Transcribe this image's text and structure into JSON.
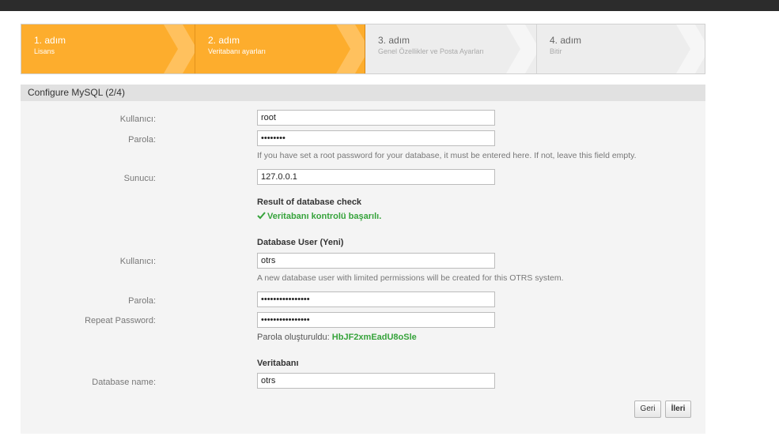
{
  "steps": [
    {
      "number": "1. adım",
      "label": "Lisans",
      "state": "done"
    },
    {
      "number": "2. adım",
      "label": "Veritabanı ayarları",
      "state": "active"
    },
    {
      "number": "3. adım",
      "label": "Genel Özellikler ve Posta Ayarları",
      "state": "pending"
    },
    {
      "number": "4. adım",
      "label": "Bitir",
      "state": "pending"
    }
  ],
  "panel": {
    "title": "Configure MySQL (2/4)"
  },
  "root_user": {
    "label": "Kullanıcı:",
    "value": "root"
  },
  "root_password": {
    "label": "Parola:",
    "value": "••••••••",
    "hint": "If you have set a root password for your database, it must be entered here. If not, leave this field empty."
  },
  "host": {
    "label": "Sunucu:",
    "value": "127.0.0.1"
  },
  "check": {
    "heading": "Result of database check",
    "result": "Veritabanı kontrolü başarılı."
  },
  "db_user_section": {
    "heading": "Database User (Yeni)",
    "user_label": "Kullanıcı:",
    "user_value": "otrs",
    "user_hint": "A new database user with limited permissions will be created for this OTRS system.",
    "password_label": "Parola:",
    "password_value": "••••••••••••••••",
    "repeat_label": "Repeat Password:",
    "repeat_value": "••••••••••••••••",
    "generated_label": "Parola oluşturuldu:",
    "generated_value": "HbJF2xmEadU8oSle"
  },
  "database": {
    "heading": "Veritabanı",
    "name_label": "Database name:",
    "name_value": "otrs"
  },
  "buttons": {
    "back": "Geri",
    "next": "İleri"
  },
  "colors": {
    "active_step": "#fdad2d",
    "success": "#36a33b",
    "topbar": "#2c2c2c"
  }
}
